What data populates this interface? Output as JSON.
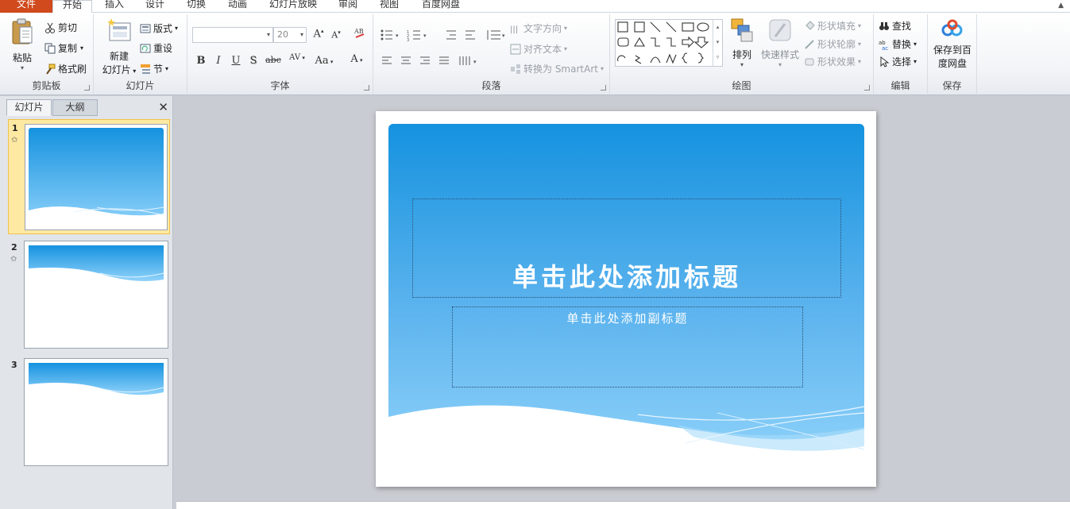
{
  "tabs": [
    "文件",
    "开始",
    "插入",
    "设计",
    "切换",
    "动画",
    "幻灯片放映",
    "审阅",
    "视图",
    "百度网盘"
  ],
  "ribbon": {
    "clipboard": {
      "label": "剪贴板",
      "paste": "粘贴",
      "cut": "剪切",
      "copy": "复制",
      "format_painter": "格式刷"
    },
    "slides": {
      "label": "幻灯片",
      "new_line1": "新建",
      "new_line2": "幻灯片",
      "layout": "版式",
      "reset": "重设",
      "section": "节"
    },
    "font": {
      "label": "字体",
      "font_name": "",
      "font_size": "20",
      "bold": "B",
      "italic": "I",
      "underline": "U",
      "shadow": "S",
      "strike": "abc",
      "spacing": "AV",
      "case": "Aa",
      "color": "A"
    },
    "paragraph": {
      "label": "段落",
      "text_direction": "文字方向",
      "align_text": "对齐文本",
      "smartart": "转换为 SmartArt"
    },
    "drawing": {
      "label": "绘图",
      "arrange": "排列",
      "quick_styles": "快速样式",
      "shape_fill": "形状填充",
      "shape_outline": "形状轮廓",
      "shape_effects": "形状效果"
    },
    "editing": {
      "label": "编辑",
      "find": "查找",
      "replace": "替换",
      "select": "选择"
    },
    "save": {
      "label": "保存",
      "line1": "保存到百",
      "line2": "度网盘"
    }
  },
  "panel": {
    "tab_slides": "幻灯片",
    "tab_outline": "大纲",
    "slides": [
      {
        "num": "1"
      },
      {
        "num": "2"
      },
      {
        "num": "3"
      }
    ]
  },
  "slide": {
    "title": "单击此处添加标题",
    "subtitle": "单击此处添加副标题"
  },
  "colors": {
    "file_tab": "#d04a1d",
    "sky_top": "#1592df",
    "sky_bottom": "#8fd2fa",
    "selected_thumb": "#fde9a2"
  }
}
